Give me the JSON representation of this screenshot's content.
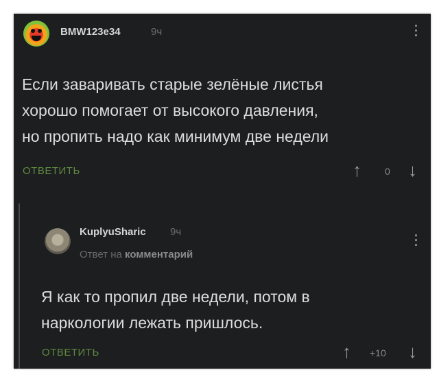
{
  "comment": {
    "author": "BMW123e34",
    "time": "9ч",
    "text_lines": [
      "Если заваривать старые зелёные листья",
      "хорошо помогает от высокого давления,",
      "но пропить надо как минимум две недели"
    ],
    "reply_label": "ОТВЕТИТЬ",
    "rating": "0"
  },
  "reply_comment": {
    "author": "KuplyuSharic",
    "time": "9ч",
    "context_prefix": "Ответ на",
    "context_link": "комментарий",
    "text_lines": [
      "Я как то пропил две недели, потом в",
      "наркологии лежать пришлось."
    ],
    "reply_label": "ОТВЕТИТЬ",
    "rating": "+10"
  },
  "icons": {
    "upvote": "arrow-up-icon",
    "downvote": "arrow-down-icon",
    "menu": "vertical-dots-icon"
  }
}
